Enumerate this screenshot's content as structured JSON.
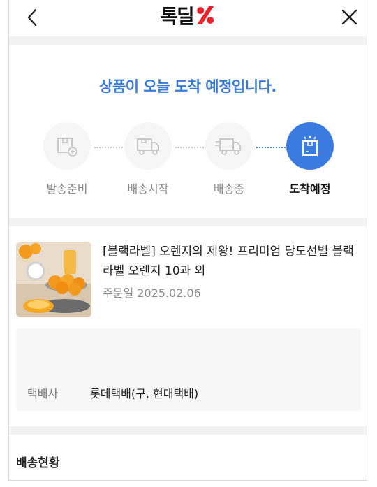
{
  "header": {
    "logo_text": "톡딜",
    "back_icon": "chevron-left-icon",
    "close_icon": "close-icon"
  },
  "delivery": {
    "status_title": "상품이 오늘 도착 예정입니다.",
    "accent_color": "#3b7be0",
    "steps": [
      {
        "label": "발송준비",
        "icon": "package-ready-icon",
        "active": false
      },
      {
        "label": "배송시작",
        "icon": "truck-icon",
        "active": false
      },
      {
        "label": "배송중",
        "icon": "truck-moving-icon",
        "active": false
      },
      {
        "label": "도착예정",
        "icon": "package-arrived-icon",
        "active": true
      }
    ]
  },
  "order": {
    "product_name": "[블랙라벨] 오렌지의 제왕! 프리미엄 당도선별 블랙라벨 오렌지 10과 외",
    "order_date": "주문일 2025.02.06",
    "carrier_label": "택배사",
    "carrier_value": "롯데택배(구. 현대택배)"
  },
  "history": {
    "title": "배송현황"
  }
}
